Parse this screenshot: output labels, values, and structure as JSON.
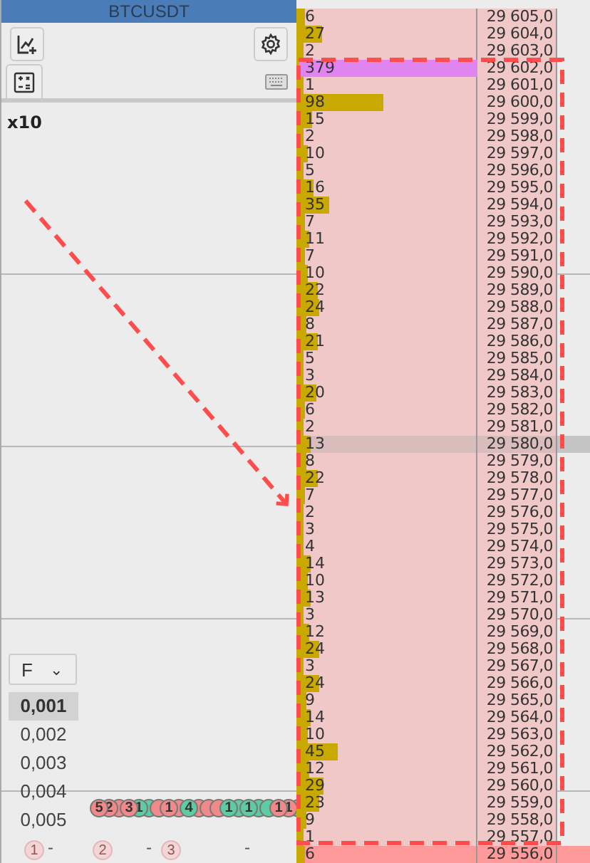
{
  "header": {
    "title": "BTCUSDT"
  },
  "multiplier": "x10",
  "filter": {
    "value": "F",
    "caret": "⌄"
  },
  "steps": [
    {
      "label": "0,001",
      "selected": true
    },
    {
      "label": "0,002",
      "selected": false
    },
    {
      "label": "0,003",
      "selected": false
    },
    {
      "label": "0,004",
      "selected": false
    },
    {
      "label": "0,005",
      "selected": false
    }
  ],
  "bubbles": [
    {
      "label": "5",
      "color": "#f08a8a"
    },
    {
      "label": "2",
      "color": "#f08a8a"
    },
    {
      "color": "#f08a8a"
    },
    {
      "label": "3",
      "color": "#f08a8a"
    },
    {
      "label": "1",
      "color": "#5ecba1"
    },
    {
      "color": "#5ecba1"
    },
    {
      "color": "#f08a8a"
    },
    {
      "label": "1",
      "color": "#f08a8a"
    },
    {
      "color": "#f08a8a"
    },
    {
      "label": "4",
      "color": "#5ecba1"
    },
    {
      "color": "#f08a8a"
    },
    {
      "color": "#f08a8a"
    },
    {
      "color": "#f08a8a"
    },
    {
      "label": "1",
      "color": "#5ecba1"
    },
    {
      "color": "#5ecba1"
    },
    {
      "label": "1",
      "color": "#5ecba1"
    },
    {
      "color": "#5ecba1"
    },
    {
      "color": "#5ecba1"
    },
    {
      "label": "1",
      "color": "#f08a8a"
    },
    {
      "label": "1",
      "color": "#f08a8a"
    },
    {
      "color": "#5ecba1"
    }
  ],
  "ghost_bubbles": [
    "1",
    "2",
    "3"
  ],
  "time_labels": [
    "-",
    "-",
    "-"
  ],
  "rows": [
    {
      "volume": "6",
      "price": "29 605,0",
      "level": 0.029,
      "kind": "normal"
    },
    {
      "volume": "27",
      "price": "29 604,0",
      "level": 0.13,
      "kind": "normal"
    },
    {
      "volume": "2",
      "price": "29 603,0",
      "level": 0.01,
      "kind": "normal"
    },
    {
      "volume": "379",
      "price": "29 602,0",
      "level": 1,
      "kind": "large"
    },
    {
      "volume": "1",
      "price": "29 601,0",
      "level": 0.005,
      "kind": "normal"
    },
    {
      "volume": "98",
      "price": "29 600,0",
      "level": 0.47,
      "kind": "normal"
    },
    {
      "volume": "15",
      "price": "29 599,0",
      "level": 0.072,
      "kind": "normal"
    },
    {
      "volume": "2",
      "price": "29 598,0",
      "level": 0.01,
      "kind": "normal"
    },
    {
      "volume": "10",
      "price": "29 597,0",
      "level": 0.048,
      "kind": "normal"
    },
    {
      "volume": "5",
      "price": "29 596,0",
      "level": 0.024,
      "kind": "normal"
    },
    {
      "volume": "16",
      "price": "29 595,0",
      "level": 0.077,
      "kind": "normal"
    },
    {
      "volume": "35",
      "price": "29 594,0",
      "level": 0.17,
      "kind": "normal"
    },
    {
      "volume": "7",
      "price": "29 593,0",
      "level": 0.034,
      "kind": "normal"
    },
    {
      "volume": "11",
      "price": "29 592,0",
      "level": 0.053,
      "kind": "normal"
    },
    {
      "volume": "7",
      "price": "29 591,0",
      "level": 0.034,
      "kind": "normal"
    },
    {
      "volume": "10",
      "price": "29 590,0",
      "level": 0.048,
      "kind": "normal"
    },
    {
      "volume": "22",
      "price": "29 589,0",
      "level": 0.106,
      "kind": "normal"
    },
    {
      "volume": "24",
      "price": "29 588,0",
      "level": 0.115,
      "kind": "normal"
    },
    {
      "volume": "8",
      "price": "29 587,0",
      "level": 0.038,
      "kind": "normal"
    },
    {
      "volume": "21",
      "price": "29 586,0",
      "level": 0.1,
      "kind": "normal"
    },
    {
      "volume": "5",
      "price": "29 585,0",
      "level": 0.024,
      "kind": "normal"
    },
    {
      "volume": "3",
      "price": "29 584,0",
      "level": 0.014,
      "kind": "normal"
    },
    {
      "volume": "20",
      "price": "29 583,0",
      "level": 0.096,
      "kind": "normal"
    },
    {
      "volume": "6",
      "price": "29 582,0",
      "level": 0.029,
      "kind": "normal"
    },
    {
      "volume": "2",
      "price": "29 581,0",
      "level": 0.01,
      "kind": "normal"
    },
    {
      "volume": "13",
      "price": "29 580,0",
      "level": 0.062,
      "kind": "cursor"
    },
    {
      "volume": "8",
      "price": "29 579,0",
      "level": 0.038,
      "kind": "normal"
    },
    {
      "volume": "22",
      "price": "29 578,0",
      "level": 0.106,
      "kind": "normal"
    },
    {
      "volume": "7",
      "price": "29 577,0",
      "level": 0.034,
      "kind": "normal"
    },
    {
      "volume": "2",
      "price": "29 576,0",
      "level": 0.01,
      "kind": "normal"
    },
    {
      "volume": "3",
      "price": "29 575,0",
      "level": 0.014,
      "kind": "normal"
    },
    {
      "volume": "4",
      "price": "29 574,0",
      "level": 0.019,
      "kind": "normal"
    },
    {
      "volume": "14",
      "price": "29 573,0",
      "level": 0.067,
      "kind": "normal"
    },
    {
      "volume": "10",
      "price": "29 572,0",
      "level": 0.048,
      "kind": "normal"
    },
    {
      "volume": "13",
      "price": "29 571,0",
      "level": 0.062,
      "kind": "normal"
    },
    {
      "volume": "3",
      "price": "29 570,0",
      "level": 0.014,
      "kind": "normal"
    },
    {
      "volume": "12",
      "price": "29 569,0",
      "level": 0.058,
      "kind": "normal"
    },
    {
      "volume": "24",
      "price": "29 568,0",
      "level": 0.115,
      "kind": "normal"
    },
    {
      "volume": "3",
      "price": "29 567,0",
      "level": 0.014,
      "kind": "normal"
    },
    {
      "volume": "24",
      "price": "29 566,0",
      "level": 0.115,
      "kind": "normal"
    },
    {
      "volume": "9",
      "price": "29 565,0",
      "level": 0.043,
      "kind": "normal"
    },
    {
      "volume": "14",
      "price": "29 564,0",
      "level": 0.067,
      "kind": "normal"
    },
    {
      "volume": "10",
      "price": "29 563,0",
      "level": 0.048,
      "kind": "normal"
    },
    {
      "volume": "45",
      "price": "29 562,0",
      "level": 0.216,
      "kind": "normal"
    },
    {
      "volume": "12",
      "price": "29 561,0",
      "level": 0.058,
      "kind": "normal"
    },
    {
      "volume": "29",
      "price": "29 560,0",
      "level": 0.139,
      "kind": "normal"
    },
    {
      "volume": "23",
      "price": "29 559,0",
      "level": 0.11,
      "kind": "normal"
    },
    {
      "volume": "9",
      "price": "29 558,0",
      "level": 0.043,
      "kind": "normal"
    },
    {
      "volume": "1",
      "price": "29 557,0",
      "level": 0.005,
      "kind": "normal"
    },
    {
      "volume": "6",
      "price": "29 556,0",
      "level": 0.029,
      "kind": "current"
    }
  ]
}
